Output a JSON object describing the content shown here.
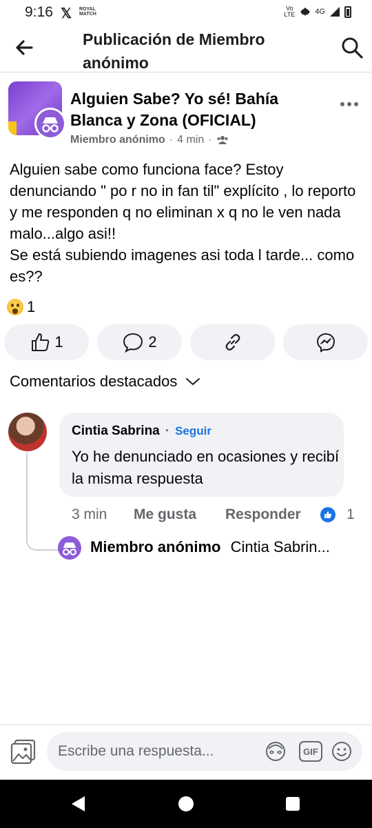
{
  "status_bar": {
    "time": "9:16",
    "x_logo": "𝕏",
    "royal_match": "ROYAL MATCH",
    "volte": "Vo LTE",
    "network": "4G"
  },
  "header": {
    "title": "Publicación de Miembro anónimo",
    "back_icon": "arrow-left-icon",
    "search_icon": "search-icon"
  },
  "post": {
    "group_name": "Alguien Sabe? Yo sé! Bahía Blanca y Zona (OFICIAL)",
    "author": "Miembro anónimo",
    "time": "4 min",
    "separator": "·",
    "audience_icon": "group-icon",
    "body": "Alguien sabe como funciona face? Estoy denunciando \" po r no in fan til\" explícito , lo reporto y me responden q no eliminan x q no le ven nada malo...algo asi!!\nSe está subiendo imagenes asi toda l tarde... como es??",
    "reaction_count": "1",
    "reaction_icon": "wow-reaction-icon"
  },
  "actions": {
    "like_count": "1",
    "comment_count": "2",
    "like_icon": "thumbs-up-icon",
    "comment_icon": "comment-icon",
    "share_icon": "link-icon",
    "messenger_icon": "messenger-icon"
  },
  "comments": {
    "filter_label": "Comentarios destacados",
    "items": [
      {
        "author": "Cintia Sabrina",
        "follow_label": "Seguir",
        "text": "Yo he denunciado en ocasiones y recibí la misma respuesta",
        "time": "3 min",
        "like_label": "Me gusta",
        "reply_label": "Responder",
        "like_count": "1"
      }
    ],
    "reply_preview": {
      "author": "Miembro anónimo",
      "text": "Cintia Sabrin..."
    }
  },
  "composer": {
    "placeholder": "Escribe una respuesta...",
    "gif_label": "GIF"
  },
  "colors": {
    "accent": "#1b74e4",
    "secondary_text": "#65676b",
    "bubble_bg": "#f0f2f5",
    "anon_avatar": "#8c5cd9"
  }
}
